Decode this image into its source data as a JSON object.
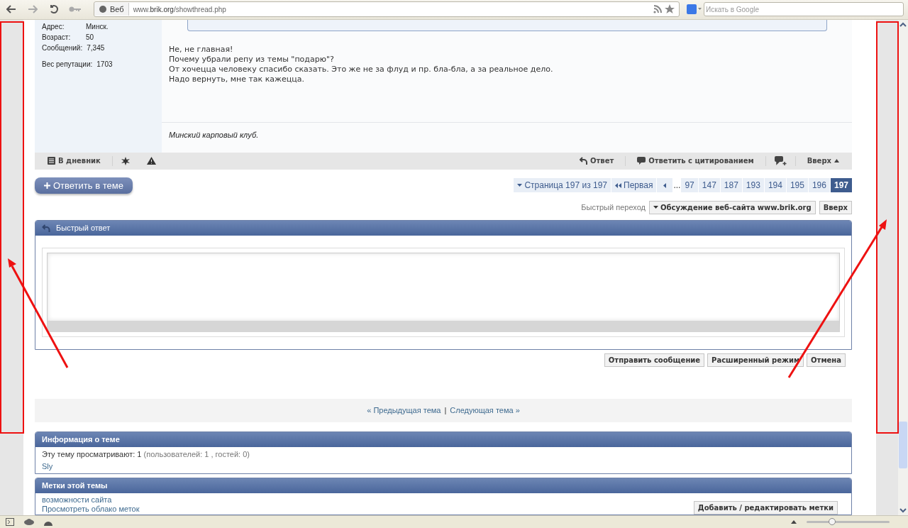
{
  "browser": {
    "engine_button": "Веб",
    "url": "www.**brik.org**/showthread.php",
    "search_placeholder": "Искать в Google"
  },
  "user_info": [
    {
      "label": "Адрес:",
      "value": "Минск."
    },
    {
      "label": "Возраст:",
      "value": "50"
    },
    {
      "label": "Сообщений:",
      "value": "7,345"
    },
    {
      "label": "Вес репутации:",
      "value": "1703"
    }
  ],
  "post": {
    "lines": [
      "Не, не главная!",
      "Почему убрали репу из темы \"подарю\"?",
      "От хочецца человеку спасибо сказать. Это же не за флуд и пр. бла-бла, а за реальное дело.",
      "Надо вернуть, мне так кажецца."
    ],
    "signature": "Минский карповый клуб."
  },
  "post_actions": {
    "diary": "В дневник",
    "reply": "Ответ",
    "quote": "Ответить с цитированием",
    "top": "Вверх"
  },
  "reply_button": "Ответить в теме",
  "pagination": {
    "summary": "Страница 197 из 197",
    "first": "Первая",
    "ellipsis": "...",
    "pages": [
      {
        "label": "97",
        "selected": false
      },
      {
        "label": "147",
        "selected": false
      },
      {
        "label": "187",
        "selected": false
      },
      {
        "label": "193",
        "selected": false
      },
      {
        "label": "194",
        "selected": false
      },
      {
        "label": "195",
        "selected": false
      },
      {
        "label": "196",
        "selected": false
      },
      {
        "label": "197",
        "selected": true
      }
    ]
  },
  "quick_nav": {
    "label": "Быстрый переход",
    "select": "Обсуждение веб-сайта www.brik.org",
    "button": "Вверх"
  },
  "quick_reply": {
    "title": "Быстрый ответ",
    "buttons": [
      "Отправить сообщение",
      "Расширенный режим",
      "Отмена"
    ]
  },
  "thread_nav": {
    "prev": "« Предыдущая тема",
    "separator": "|",
    "next": "Следующая тема »"
  },
  "thread_info": {
    "title": "Информация о теме",
    "viewers": "Эту тему просматривают: 1",
    "details": "(пользователей: 1 , гостей: 0)",
    "users": [
      "Sly"
    ]
  },
  "tags": {
    "title": "Метки этой темы",
    "links": [
      "возможности сайта",
      "Просмотреть облако меток"
    ],
    "button": "Добавить / редактировать метки"
  },
  "status_bar": {
    "zoom": {
      "level": 0.31
    }
  }
}
